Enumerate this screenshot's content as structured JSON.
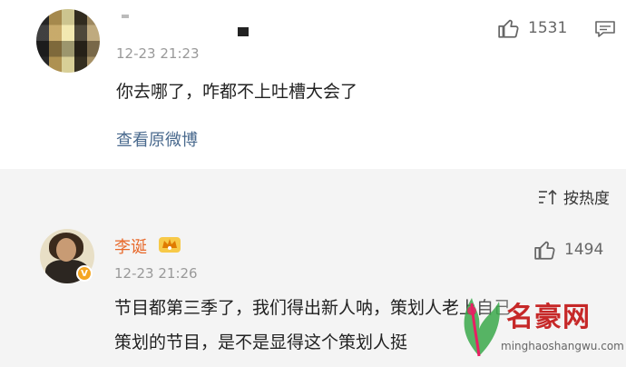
{
  "comment1": {
    "timestamp": "12-23 21:23",
    "text": "你去哪了，咋都不上吐槽大会了",
    "view_original": "查看原微博",
    "likes": "1531",
    "like_icon": "thumbs-up-icon",
    "comment_icon": "comment-icon"
  },
  "sort_bar": {
    "label": "按热度",
    "icon": "sort-icon"
  },
  "comment2": {
    "author": "李诞",
    "timestamp": "12-23 21:26",
    "line1": "节目都第三季了，我们得出新人呐，策划人老上自己",
    "line2": "策划的节目，是不是显得这个策划人挺",
    "likes": "1494",
    "verified": "V"
  },
  "watermark": {
    "title": "名豪网",
    "subtitle": "minghaoshangwu.com"
  },
  "colors": {
    "author": "#e86a2c",
    "link": "#4a6a8e",
    "watermark": "#c62828",
    "background_gray": "#f4f4f4"
  }
}
